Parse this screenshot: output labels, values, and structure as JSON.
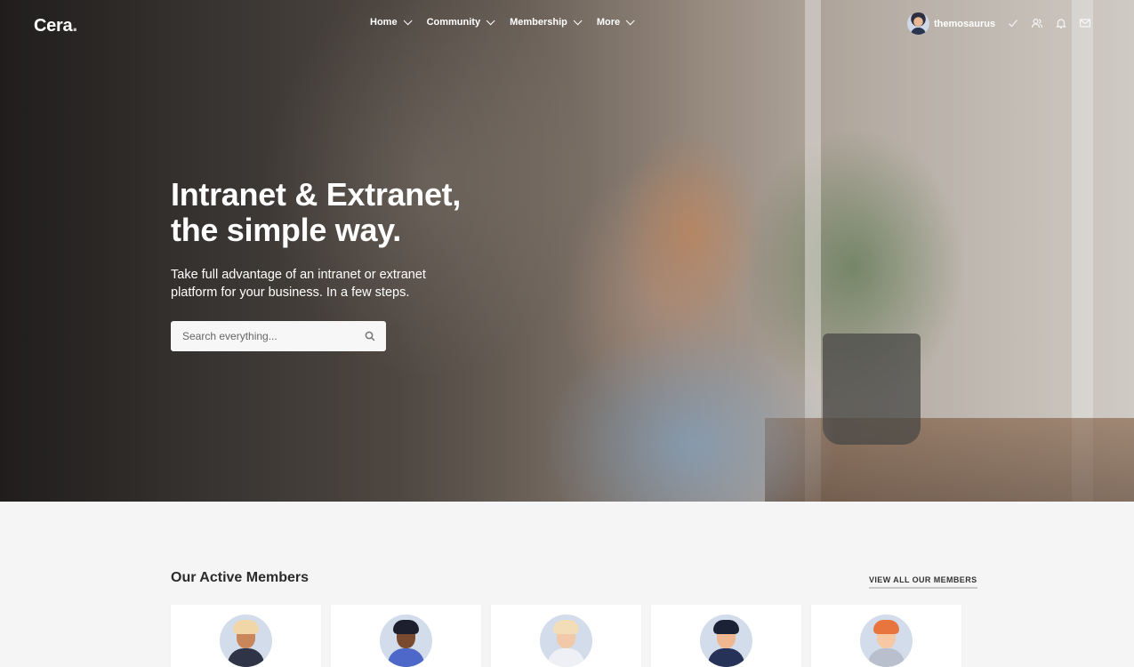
{
  "brand": {
    "name": "Cera",
    "dot": "."
  },
  "nav": {
    "items": [
      {
        "label": "Home"
      },
      {
        "label": "Community"
      },
      {
        "label": "Membership"
      },
      {
        "label": "More"
      }
    ],
    "user": {
      "name": "themosaurus"
    },
    "icons": [
      "check-icon",
      "users-icon",
      "bell-icon",
      "mail-icon"
    ]
  },
  "hero": {
    "headline_line1": "Intranet & Extranet,",
    "headline_line2": "the simple way.",
    "subtitle": "Take full advantage of an intranet or extranet platform for your business. In a few steps.",
    "search": {
      "placeholder": "Search everything..."
    }
  },
  "members": {
    "title": "Our Active Members",
    "view_all": "VIEW ALL OUR MEMBERS",
    "avatars": [
      {
        "skin": "#c8865a",
        "hair": "#f1d6a8",
        "body": "#2f3446"
      },
      {
        "skin": "#7a4a30",
        "hair": "#1e1f2e",
        "body": "#4d68c8"
      },
      {
        "skin": "#f1c9a8",
        "hair": "#f3dcb8",
        "body": "#eef0f5"
      },
      {
        "skin": "#f0b690",
        "hair": "#1c2235",
        "body": "#263257"
      },
      {
        "skin": "#f6c8a4",
        "hair": "#e8743e",
        "body": "#b9bfcc"
      }
    ]
  },
  "colors": {
    "accent": "#ffffff",
    "page_bg": "#f5f5f5"
  }
}
